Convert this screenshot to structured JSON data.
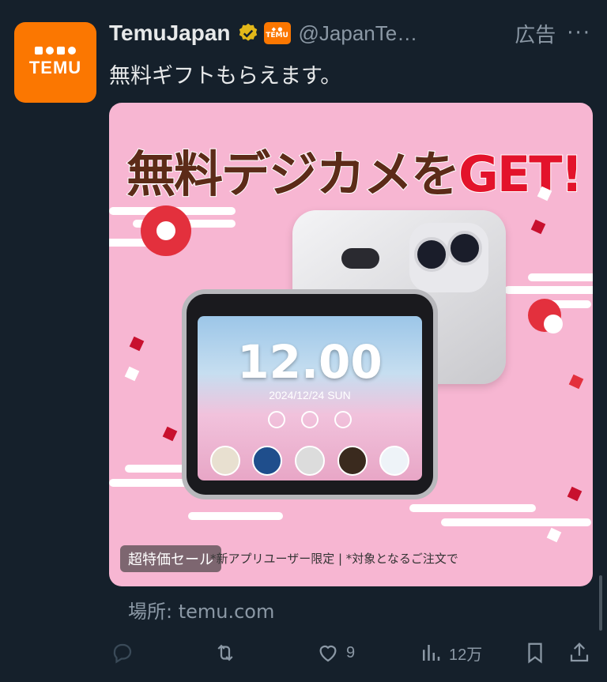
{
  "tweet": {
    "author_name": "TemuJapan",
    "avatar_text": "TEMU",
    "badge_text": "TEMU",
    "handle": "@JapanTe…",
    "ad_label": "広告",
    "more": "···",
    "text": "無料ギフトもらえます。"
  },
  "media": {
    "headline_main": "無料デジカメを",
    "headline_accent": "GET!",
    "clock": "12.00",
    "date": "2024/12/24 SUN",
    "sale_badge": "超特価セール",
    "caption": "*新アプリユーザー限定 | *対象となるご注文で"
  },
  "source": "場所: temu.com",
  "actions": {
    "reply_count": "",
    "retweet_count": "",
    "like_count": "9",
    "views_count": "12万",
    "bookmark_count": "",
    "share_count": ""
  },
  "colors": {
    "background": "#15202b",
    "brand": "#fb7701",
    "media_bg": "#f7b6d2",
    "accent_red": "#e3132b",
    "muted_text": "#8b98a5"
  }
}
